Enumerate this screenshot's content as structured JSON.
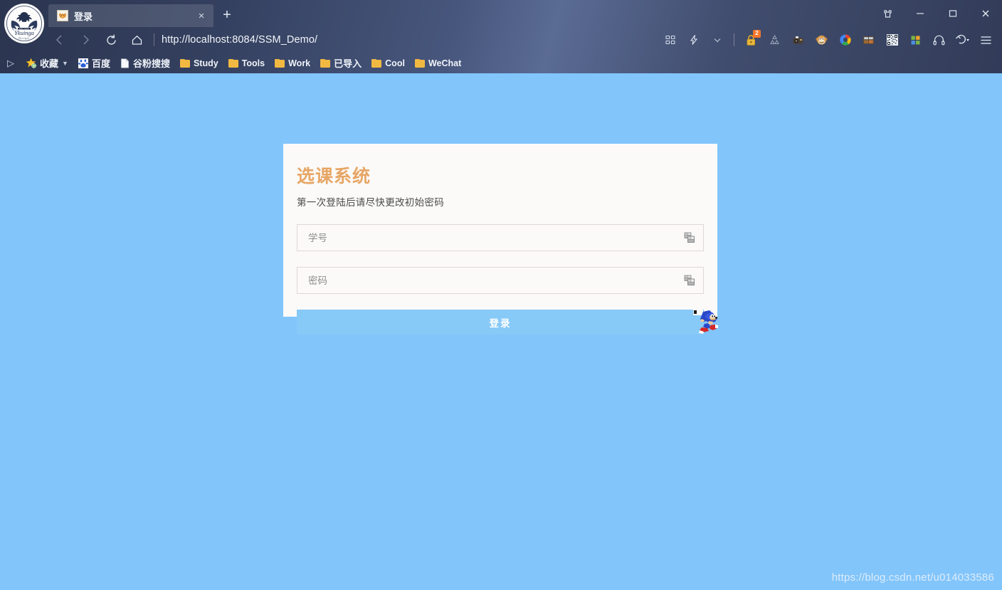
{
  "browser": {
    "logo": {
      "name": "ykuinga-designs-logo",
      "text_top": "ARCANE",
      "text_main": "Ykuinga",
      "text_bottom": "Designs"
    },
    "tabs": [
      {
        "title": "登录",
        "favicon": "fox-favicon",
        "close_label": "×"
      }
    ],
    "new_tab_label": "+",
    "window_controls": [
      {
        "name": "skin-icon",
        "label": "skin"
      },
      {
        "name": "minimize-button",
        "label": "minimize"
      },
      {
        "name": "maximize-button",
        "label": "maximize"
      },
      {
        "name": "close-button",
        "label": "close"
      }
    ],
    "nav": {
      "back_label": "back",
      "forward_label": "forward",
      "reload_label": "reload",
      "home_label": "home",
      "url": "http://localhost:8084/SSM_Demo/"
    },
    "toolbar_icons": [
      {
        "name": "apps-grid-icon",
        "label": "apps"
      },
      {
        "name": "lightning-icon",
        "label": "speed"
      },
      {
        "name": "chevron-down-icon",
        "label": "more"
      },
      {
        "name": "lock-icon",
        "label": "password-manager",
        "badge": "2"
      },
      {
        "name": "recycle-icon",
        "label": "recycle"
      },
      {
        "name": "camera-icon",
        "label": "screenshot"
      },
      {
        "name": "monkey-icon",
        "label": "tampermonkey"
      },
      {
        "name": "color-ring-icon",
        "label": "extension"
      },
      {
        "name": "dual-panel-icon",
        "label": "split-screen"
      },
      {
        "name": "qrcode-icon",
        "label": "qr-code"
      },
      {
        "name": "four-squares-icon",
        "label": "tiles"
      },
      {
        "name": "headphones-icon",
        "label": "audio"
      },
      {
        "name": "undo-icon",
        "label": "restore"
      },
      {
        "name": "menu-icon",
        "label": "main-menu"
      }
    ],
    "bookmarks": {
      "expand_label": "▷",
      "items": [
        {
          "label": "收藏",
          "icon": "star-icon",
          "has_chevron": true,
          "cn": true
        },
        {
          "label": "百度",
          "icon": "baidu-icon",
          "cn": true
        },
        {
          "label": "谷粉搜搜",
          "icon": "page-icon",
          "cn": true
        },
        {
          "label": "Study",
          "icon": "folder-icon"
        },
        {
          "label": "Tools",
          "icon": "folder-icon"
        },
        {
          "label": "Work",
          "icon": "folder-icon"
        },
        {
          "label": "已导入",
          "icon": "folder-icon",
          "cn": true
        },
        {
          "label": "Cool",
          "icon": "folder-icon"
        },
        {
          "label": "WeChat",
          "icon": "folder-icon"
        }
      ]
    }
  },
  "page": {
    "background_color": "#82c5fb",
    "card": {
      "background_color": "#fbfaf9",
      "title": "选课系统",
      "title_color": "#e7a665",
      "subtitle": "第一次登陆后请尽快更改初始密码",
      "fields": [
        {
          "name": "student-id",
          "placeholder": "学号",
          "value": "",
          "type": "text",
          "adornment": "broken-image-icon"
        },
        {
          "name": "password",
          "placeholder": "密码",
          "value": "",
          "type": "password",
          "adornment": "broken-image-icon"
        }
      ],
      "submit_label": "登录",
      "submit_color": "#87c9f7"
    },
    "sprite": {
      "name": "sonic-sprite",
      "label": "sonic running"
    },
    "watermark": "https://blog.csdn.net/u014033586"
  }
}
